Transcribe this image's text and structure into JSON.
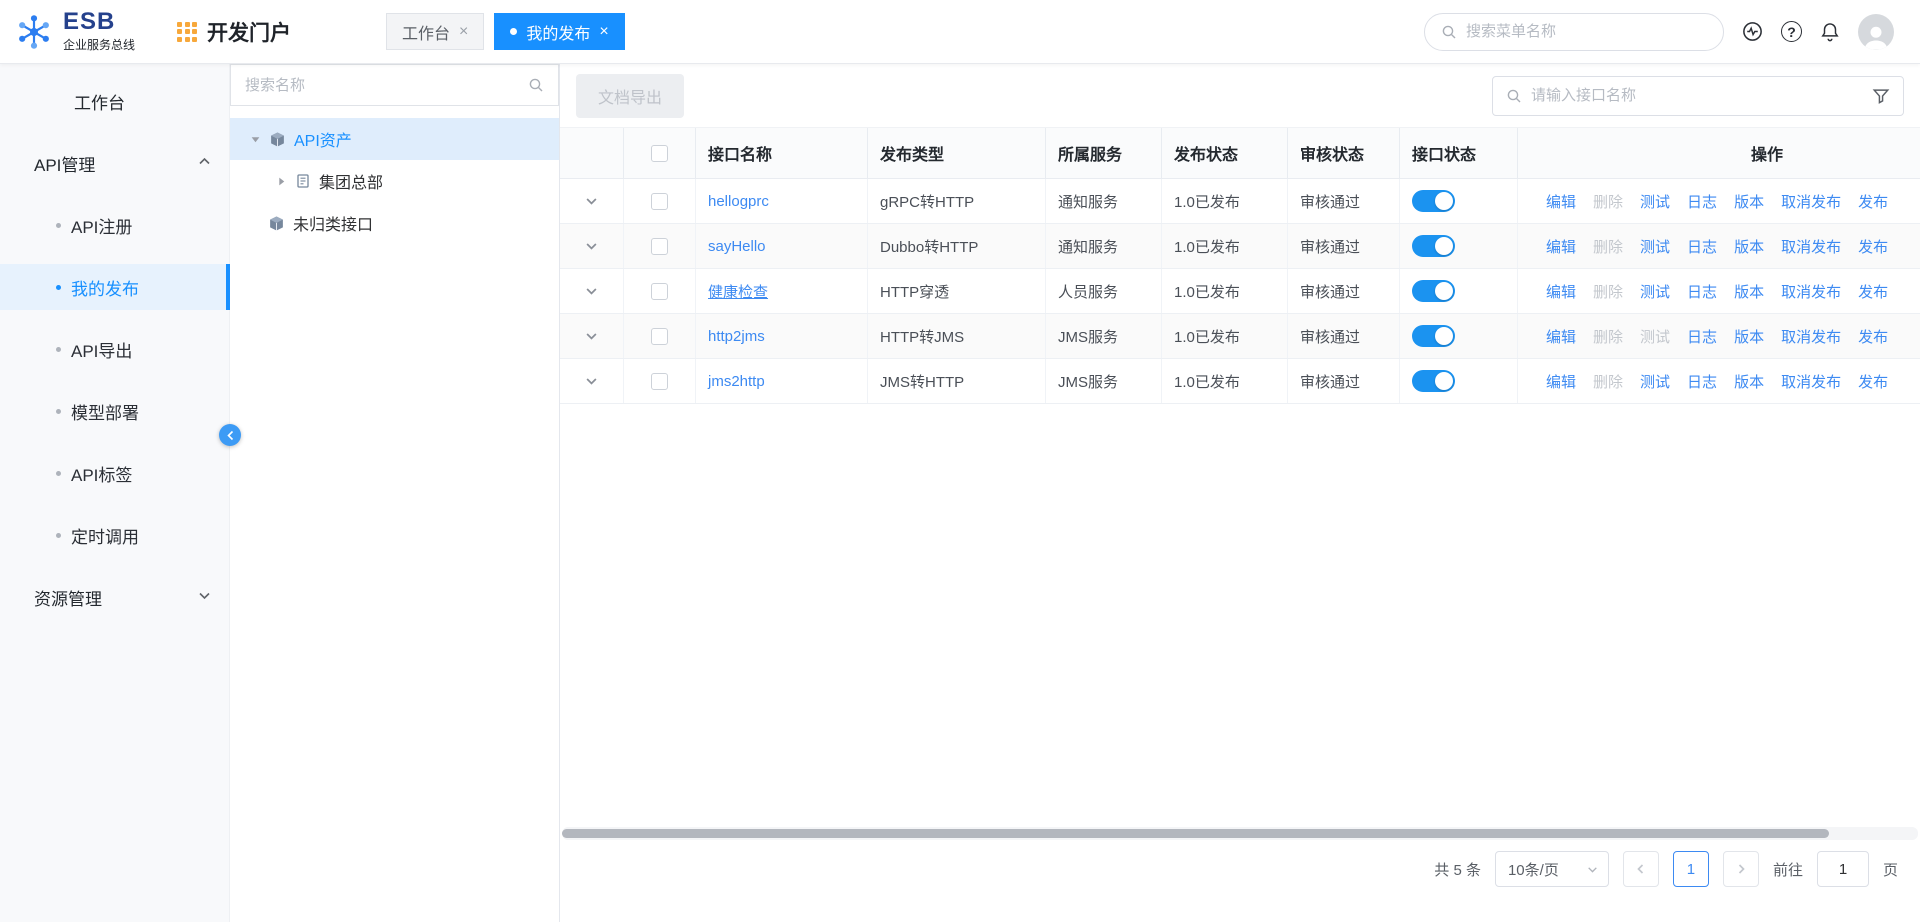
{
  "colors": {
    "accent": "#1890ff",
    "link": "#3d8af2",
    "tab_active_bg": "#1890ff",
    "sidebar_selected_bg": "#e7f2fd"
  },
  "header": {
    "logo_title": "ESB",
    "logo_subtitle": "企业服务总线",
    "portal_title": "开发门户",
    "tabs": [
      {
        "label": "工作台"
      },
      {
        "label": "我的发布"
      }
    ],
    "close_glyph": "×",
    "search_placeholder": "搜索菜单名称"
  },
  "sidebar": {
    "items": [
      {
        "label": "工作台"
      },
      {
        "label": "API管理"
      },
      {
        "label": "API注册"
      },
      {
        "label": "我的发布"
      },
      {
        "label": "API导出"
      },
      {
        "label": "模型部署"
      },
      {
        "label": "API标签"
      },
      {
        "label": "定时调用"
      },
      {
        "label": "资源管理"
      }
    ]
  },
  "tree": {
    "search_placeholder": "搜索名称",
    "nodes": [
      {
        "label": "API资产"
      },
      {
        "label": "集团总部"
      },
      {
        "label": "未归类接口"
      }
    ]
  },
  "toolbar": {
    "export_label": "文档导出",
    "search_placeholder": "请输入接口名称"
  },
  "table": {
    "columns": [
      "接口名称",
      "发布类型",
      "所属服务",
      "发布状态",
      "审核状态",
      "接口状态",
      "操作"
    ],
    "action_labels": [
      "编辑",
      "删除",
      "测试",
      "日志",
      "版本",
      "取消发布",
      "发布"
    ],
    "action_names": [
      "edit",
      "delete",
      "test",
      "log",
      "version",
      "unpublish",
      "publish"
    ],
    "rows": [
      {
        "name": "hellogprc",
        "publish_type": "gRPC转HTTP",
        "service": "通知服务",
        "publish_status": "1.0已发布",
        "audit_status": "审核通过",
        "enabled": true,
        "underline": false,
        "disabled_actions": [
          "删除"
        ]
      },
      {
        "name": "sayHello",
        "publish_type": "Dubbo转HTTP",
        "service": "通知服务",
        "publish_status": "1.0已发布",
        "audit_status": "审核通过",
        "enabled": true,
        "underline": false,
        "disabled_actions": [
          "删除"
        ]
      },
      {
        "name": "健康检查",
        "publish_type": "HTTP穿透",
        "service": "人员服务",
        "publish_status": "1.0已发布",
        "audit_status": "审核通过",
        "enabled": true,
        "underline": true,
        "disabled_actions": [
          "删除"
        ]
      },
      {
        "name": "http2jms",
        "publish_type": "HTTP转JMS",
        "service": "JMS服务",
        "publish_status": "1.0已发布",
        "audit_status": "审核通过",
        "enabled": true,
        "underline": false,
        "disabled_actions": [
          "删除",
          "测试"
        ]
      },
      {
        "name": "jms2http",
        "publish_type": "JMS转HTTP",
        "service": "JMS服务",
        "publish_status": "1.0已发布",
        "audit_status": "审核通过",
        "enabled": true,
        "underline": false,
        "disabled_actions": [
          "删除"
        ]
      }
    ]
  },
  "pagination": {
    "total": "共 5 条",
    "page_size": "10条/页",
    "current_page": "1",
    "goto_label": "前往",
    "goto_value": "1",
    "unit_label": "页"
  }
}
